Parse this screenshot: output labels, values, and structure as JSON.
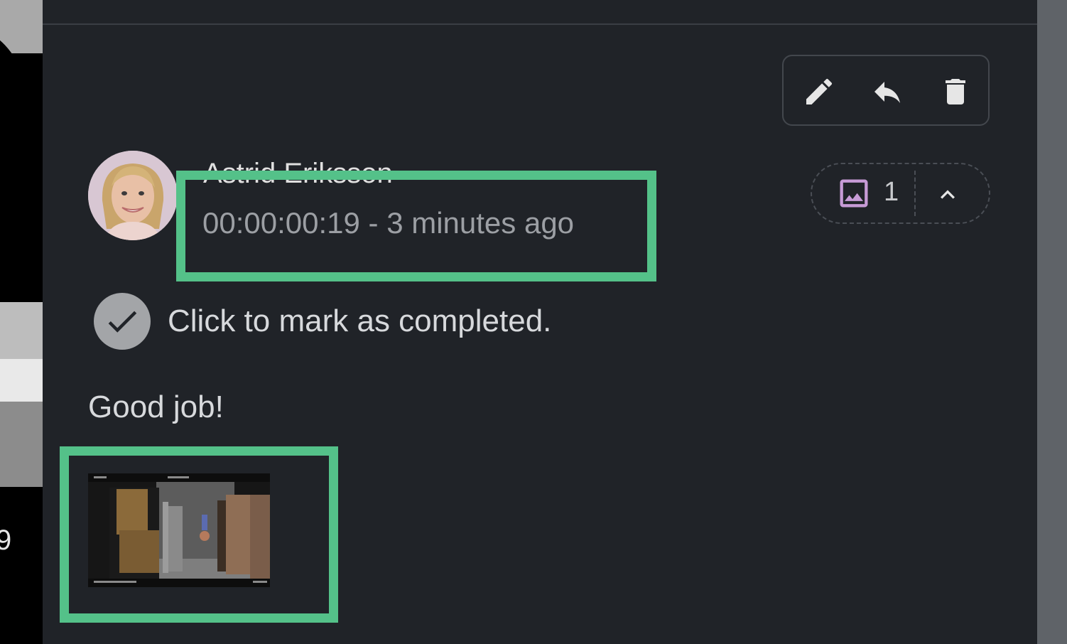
{
  "comment": {
    "author": "Astrid Eriksson",
    "timecode": "00:00:00:19",
    "separator": " - ",
    "relative_time": "3 minutes ago",
    "mark_complete_label": "Click to mark as completed.",
    "body": "Good job!",
    "attachment_count": "1"
  },
  "left_pane": {
    "partial_number": "9"
  },
  "actions": {
    "edit_icon": "pencil-icon",
    "reply_icon": "reply-icon",
    "delete_icon": "trash-icon"
  },
  "colors": {
    "panel_bg": "#202328",
    "highlight": "#54c189",
    "attachment_icon": "#c79bd6",
    "muted_text": "#9c9fa4"
  }
}
